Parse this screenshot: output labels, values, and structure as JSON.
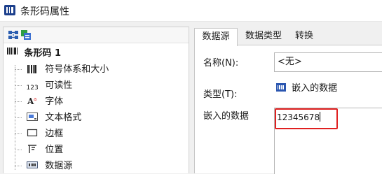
{
  "window": {
    "title": "条形码属性",
    "title_icon": "barcode-properties-icon"
  },
  "toolbar": {
    "icons": [
      "tree-expand-icon",
      "tree-collapse-icon"
    ]
  },
  "tree": {
    "root_label": "条形码 1",
    "items": [
      {
        "label": "符号体系和大小",
        "icon": "barcode-bars-icon"
      },
      {
        "label": "可读性",
        "icon_text": "123"
      },
      {
        "label": "字体",
        "icon": "font-icon"
      },
      {
        "label": "文本格式",
        "icon": "text-format-icon"
      },
      {
        "label": "边框",
        "icon": "border-icon"
      },
      {
        "label": "位置",
        "icon": "position-icon"
      },
      {
        "label": "数据源",
        "icon": "data-source-icon"
      }
    ]
  },
  "tabs": [
    {
      "label": "数据源",
      "active": true
    },
    {
      "label": "数据类型",
      "active": false
    },
    {
      "label": "转换",
      "active": false
    }
  ],
  "form": {
    "name_label": "名称(N):",
    "name_value": "<无>",
    "type_label": "类型(T):",
    "type_value": "嵌入的数据",
    "embedded_label": "嵌入的数据",
    "embedded_value": "12345678"
  },
  "colors": {
    "highlight": "#e02020",
    "icon_blue": "#1c3f8c"
  }
}
